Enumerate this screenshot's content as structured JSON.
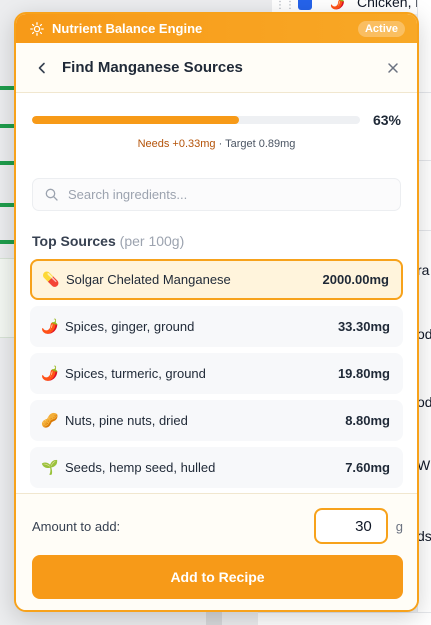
{
  "background": {
    "top_row_label": "Chicken, br",
    "right_rows": [
      "ra",
      "od",
      "od",
      "Wil",
      "ds"
    ]
  },
  "engine": {
    "title": "Nutrient Balance Engine",
    "status_badge": "Active"
  },
  "panel": {
    "title": "Find Manganese Sources"
  },
  "progress": {
    "percent": 63,
    "percent_label": "63%",
    "needs_label": "Needs +0.33mg",
    "separator": " · ",
    "target_label": "Target 0.89mg"
  },
  "search": {
    "placeholder": "Search ingredients..."
  },
  "sources": {
    "heading": "Top Sources",
    "heading_suffix": "(per 100g)",
    "items": [
      {
        "icon": "💊",
        "name": "Solgar Chelated Manganese",
        "amount": "2000.00mg",
        "selected": true
      },
      {
        "icon": "🌶️",
        "name": "Spices, ginger, ground",
        "amount": "33.30mg",
        "selected": false
      },
      {
        "icon": "🌶️",
        "name": "Spices, turmeric, ground",
        "amount": "19.80mg",
        "selected": false
      },
      {
        "icon": "🥜",
        "name": "Nuts, pine nuts, dried",
        "amount": "8.80mg",
        "selected": false
      },
      {
        "icon": "🌱",
        "name": "Seeds, hemp seed, hulled",
        "amount": "7.60mg",
        "selected": false
      }
    ]
  },
  "footer": {
    "amount_label": "Amount to add:",
    "amount_value": "30",
    "unit": "g",
    "add_button": "Add to Recipe"
  },
  "colors": {
    "accent": "#f79a18",
    "needs_text": "#b45309",
    "selected_bg": "#fff4dc"
  }
}
